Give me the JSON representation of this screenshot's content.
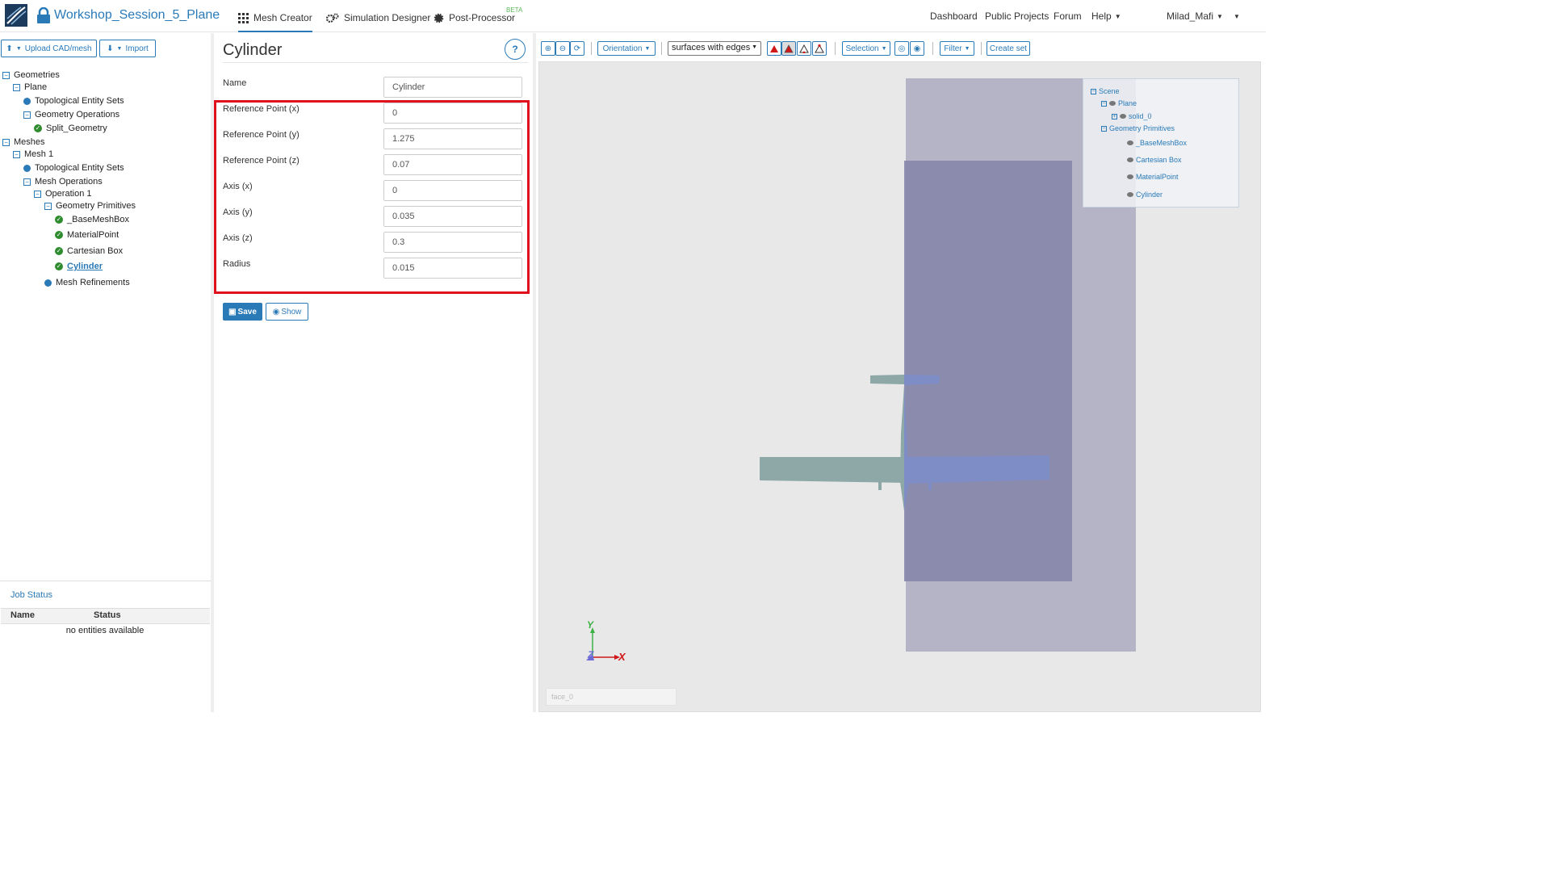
{
  "header": {
    "project_title": "Workshop_Session_5_Plane",
    "tabs": [
      {
        "label": "Mesh Creator"
      },
      {
        "label": "Simulation Designer"
      },
      {
        "label": "Post-Processor"
      }
    ],
    "beta_badge": "BETA",
    "right_nav": {
      "dashboard": "Dashboard",
      "public_projects": "Public Projects",
      "forum": "Forum",
      "help": "Help",
      "user": "Milad_Mafi"
    }
  },
  "left_panel": {
    "upload_label": "Upload CAD/mesh",
    "import_label": "Import",
    "tree": {
      "geometries": "Geometries",
      "plane": "Plane",
      "topo_sets_1": "Topological Entity Sets",
      "geometry_operations": "Geometry Operations",
      "split_geometry": "Split_Geometry",
      "meshes": "Meshes",
      "mesh1": "Mesh 1",
      "topo_sets_2": "Topological Entity Sets",
      "mesh_operations": "Mesh Operations",
      "operation1": "Operation 1",
      "geometry_primitives": "Geometry Primitives",
      "base_mesh_box": "_BaseMeshBox",
      "material_point": "MaterialPoint",
      "cartesian_box": "Cartesian Box",
      "cylinder": "Cylinder",
      "mesh_refinements": "Mesh Refinements"
    },
    "job_status": {
      "title": "Job Status",
      "col_name": "Name",
      "col_status": "Status",
      "empty": "no entities available"
    }
  },
  "form": {
    "title": "Cylinder",
    "help": "?",
    "fields": [
      {
        "label": "Name",
        "value": "Cylinder"
      },
      {
        "label": "Reference Point (x)",
        "value": "0"
      },
      {
        "label": "Reference Point (y)",
        "value": "1.275"
      },
      {
        "label": "Reference Point (z)",
        "value": "0.07"
      },
      {
        "label": "Axis (x)",
        "value": "0"
      },
      {
        "label": "Axis (y)",
        "value": "0.035"
      },
      {
        "label": "Axis (z)",
        "value": "0.3"
      },
      {
        "label": "Radius",
        "value": "0.015"
      }
    ],
    "save_label": "Save",
    "show_label": "Show"
  },
  "toolbar": {
    "orientation": "Orientation",
    "render_mode": "surfaces with edges",
    "selection": "Selection",
    "filter": "Filter",
    "create_set": "Create set"
  },
  "scene_tree": {
    "scene": "Scene",
    "plane": "Plane",
    "solid": "solid_0",
    "geometry_primitives": "Geometry Primitives",
    "items": [
      "_BaseMeshBox",
      "Cartesian Box",
      "MaterialPoint",
      "Cylinder"
    ]
  },
  "viewport": {
    "axis_y": "Y",
    "axis_z": "Z",
    "axis_x": "X",
    "face_placeholder": "face_0"
  },
  "colors": {
    "accent": "#2a7ab8",
    "highlight": "#e0101e",
    "check_green": "#2e8b2e"
  }
}
